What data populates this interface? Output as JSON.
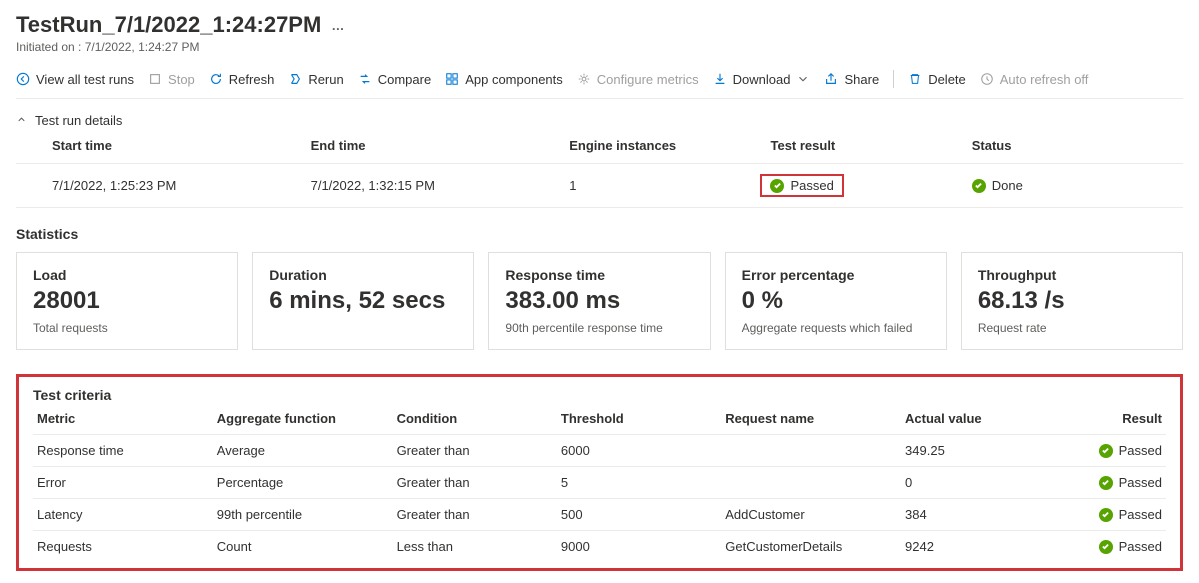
{
  "header": {
    "title": "TestRun_7/1/2022_1:24:27PM",
    "initiated_label": "Initiated on : 7/1/2022, 1:24:27 PM"
  },
  "toolbar": {
    "view_all": "View all test runs",
    "stop": "Stop",
    "refresh": "Refresh",
    "rerun": "Rerun",
    "compare": "Compare",
    "app_components": "App components",
    "configure_metrics": "Configure metrics",
    "download": "Download",
    "share": "Share",
    "delete": "Delete",
    "auto_refresh": "Auto refresh off"
  },
  "details": {
    "section_label": "Test run details",
    "headers": {
      "start_time": "Start time",
      "end_time": "End time",
      "engine_instances": "Engine instances",
      "test_result": "Test result",
      "status": "Status"
    },
    "row": {
      "start_time": "7/1/2022, 1:25:23 PM",
      "end_time": "7/1/2022, 1:32:15 PM",
      "engine_instances": "1",
      "test_result": "Passed",
      "status": "Done"
    }
  },
  "statistics": {
    "title": "Statistics",
    "cards": [
      {
        "label": "Load",
        "value": "28001",
        "desc": "Total requests"
      },
      {
        "label": "Duration",
        "value": "6 mins, 52 secs",
        "desc": ""
      },
      {
        "label": "Response time",
        "value": "383.00 ms",
        "desc": "90th percentile response time"
      },
      {
        "label": "Error percentage",
        "value": "0 %",
        "desc": "Aggregate requests which failed"
      },
      {
        "label": "Throughput",
        "value": "68.13 /s",
        "desc": "Request rate"
      }
    ]
  },
  "criteria": {
    "title": "Test criteria",
    "headers": {
      "metric": "Metric",
      "aggregate": "Aggregate function",
      "condition": "Condition",
      "threshold": "Threshold",
      "request_name": "Request name",
      "actual_value": "Actual value",
      "result": "Result"
    },
    "rows": [
      {
        "metric": "Response time",
        "aggregate": "Average",
        "condition": "Greater than",
        "threshold": "6000",
        "request_name": "",
        "actual_value": "349.25",
        "result": "Passed"
      },
      {
        "metric": "Error",
        "aggregate": "Percentage",
        "condition": "Greater than",
        "threshold": "5",
        "request_name": "",
        "actual_value": "0",
        "result": "Passed"
      },
      {
        "metric": "Latency",
        "aggregate": "99th percentile",
        "condition": "Greater than",
        "threshold": "500",
        "request_name": "AddCustomer",
        "actual_value": "384",
        "result": "Passed"
      },
      {
        "metric": "Requests",
        "aggregate": "Count",
        "condition": "Less than",
        "threshold": "9000",
        "request_name": "GetCustomerDetails",
        "actual_value": "9242",
        "result": "Passed"
      }
    ]
  },
  "colors": {
    "accent": "#0078d4",
    "highlight": "#d13438",
    "success": "#57a300"
  }
}
